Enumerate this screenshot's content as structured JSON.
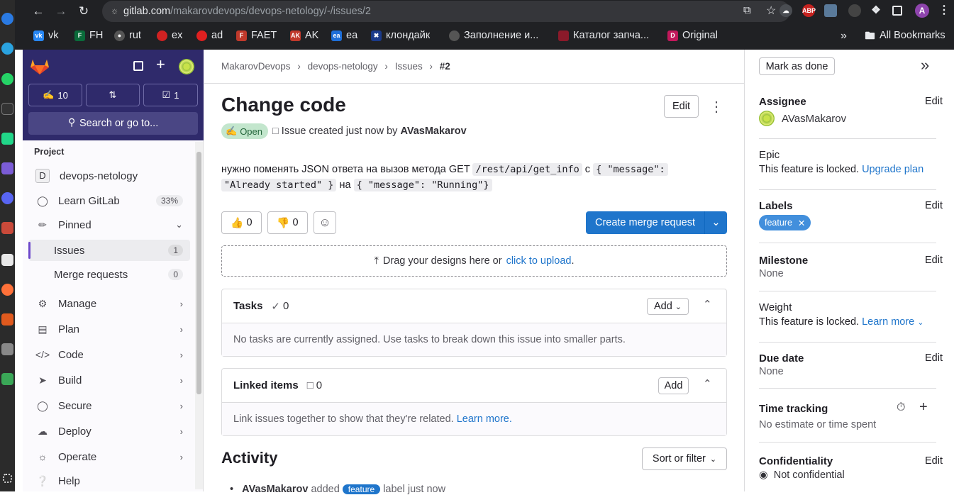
{
  "browser": {
    "url_domain": "gitlab.com",
    "url_path": "/makarovdevops/devops-netology/-/issues/2",
    "profile_initial": "A",
    "bookmarks": [
      "vk",
      "FH",
      "rut",
      "ex",
      "ad",
      "FAET",
      "AK",
      "ea",
      "клондайк",
      "Заполнение и...",
      "Каталог запча...",
      "Original"
    ],
    "all_bookmarks": "All Bookmarks",
    "abp_label": "ABP"
  },
  "sidebar": {
    "counts": {
      "issues": "10",
      "todos": "1"
    },
    "search_placeholder": "Search or go to...",
    "section": "Project",
    "project_initial": "D",
    "project_name": "devops-netology",
    "learn_gitlab": "Learn GitLab",
    "learn_progress": "33%",
    "pinned": "Pinned",
    "issues": "Issues",
    "issues_count": "1",
    "merge_requests": "Merge requests",
    "mr_count": "0",
    "menu": [
      "Manage",
      "Plan",
      "Code",
      "Build",
      "Secure",
      "Deploy",
      "Operate"
    ],
    "help": "Help"
  },
  "breadcrumb": [
    "MakarovDevops",
    "devops-netology",
    "Issues",
    "#2"
  ],
  "issue": {
    "title": "Change code",
    "edit": "Edit",
    "status": "Open",
    "meta_prefix": "Issue created just now by",
    "author": "AVasMakarov",
    "desc_1": "нужно поменять JSON ответа на вызов метода GET",
    "code_1": "/rest/api/get_info",
    "desc_2": "с",
    "code_2a": "{ \"message\":",
    "code_2b": "\"Already started\" }",
    "desc_3": "на",
    "code_3": "{ \"message\": \"Running\"}",
    "thumbs_up": "0",
    "thumbs_down": "0",
    "create_mr": "Create merge request",
    "drag_text": "Drag your designs here or",
    "drag_link": "click to upload",
    "drag_end": "."
  },
  "tasks": {
    "title": "Tasks",
    "count": "0",
    "add": "Add",
    "empty": "No tasks are currently assigned. Use tasks to break down this issue into smaller parts."
  },
  "linked": {
    "title": "Linked items",
    "count": "0",
    "add": "Add",
    "empty": "Link issues together to show that they're related.",
    "learn": "Learn more."
  },
  "activity": {
    "title": "Activity",
    "sort": "Sort or filter",
    "entry_author": "AVasMakarov",
    "entry_action": "added",
    "entry_label": "feature",
    "entry_rest": "label just now"
  },
  "right": {
    "mark_done": "Mark as done",
    "assignee_title": "Assignee",
    "edit": "Edit",
    "assignee": "AVasMakarov",
    "epic_title": "Epic",
    "locked": "This feature is locked.",
    "upgrade": "Upgrade plan",
    "labels_title": "Labels",
    "label": "feature",
    "milestone_title": "Milestone",
    "none": "None",
    "weight_title": "Weight",
    "learn_more": "Learn more",
    "due_title": "Due date",
    "time_title": "Time tracking",
    "time_value": "No estimate or time spent",
    "conf_title": "Confidentiality",
    "conf_value": "Not confidential"
  },
  "colors": {
    "brand_purple": "#2f2a6b",
    "link": "#1f75cb",
    "primary": "#1f75cb",
    "open_green": "#108548"
  }
}
